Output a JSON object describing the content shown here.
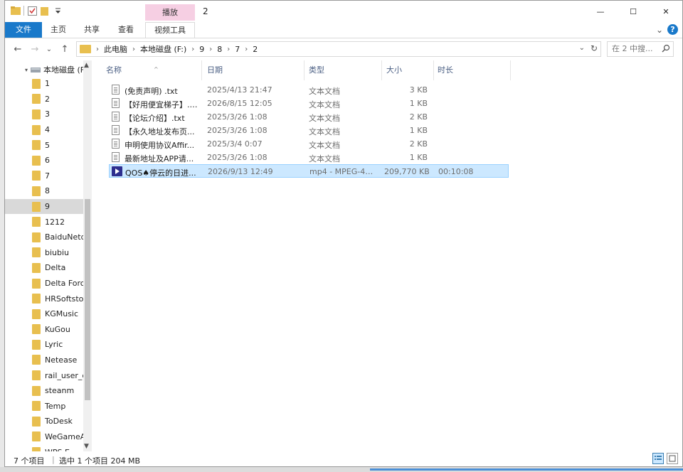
{
  "window": {
    "title": "2",
    "context_tab_group": "播放",
    "controls": {
      "minimize": "—",
      "maximize": "☐",
      "close": "✕"
    }
  },
  "ribbon": {
    "tabs": [
      {
        "label": "文件",
        "active": true
      },
      {
        "label": "主页"
      },
      {
        "label": "共享"
      },
      {
        "label": "查看"
      },
      {
        "label": "视频工具"
      }
    ],
    "collapse_glyph": "⌄",
    "help_glyph": "?"
  },
  "address": {
    "breadcrumbs": [
      "此电脑",
      "本地磁盘 (F:)",
      "9",
      "8",
      "7",
      "2"
    ],
    "search_placeholder": "在 2 中搜...",
    "back_glyph": "←",
    "forward_glyph": "→",
    "up_glyph": "↑",
    "recent_glyph": "⌄",
    "dropdown_glyph": "⌄",
    "refresh_glyph": "↻"
  },
  "nav_pane": {
    "root": "本地磁盘 (F:)",
    "expand_glyph": "▾",
    "items": [
      {
        "label": "1"
      },
      {
        "label": "2"
      },
      {
        "label": "3"
      },
      {
        "label": "4"
      },
      {
        "label": "5"
      },
      {
        "label": "6"
      },
      {
        "label": "7"
      },
      {
        "label": "8"
      },
      {
        "label": "9",
        "selected": true
      },
      {
        "label": "1212"
      },
      {
        "label": "BaiduNetd"
      },
      {
        "label": "biubiu"
      },
      {
        "label": "Delta"
      },
      {
        "label": "Delta Forc"
      },
      {
        "label": "HRSoftsto"
      },
      {
        "label": "KGMusic"
      },
      {
        "label": "KuGou"
      },
      {
        "label": "Lyric"
      },
      {
        "label": "Netease"
      },
      {
        "label": "rail_user_c"
      },
      {
        "label": "steanm"
      },
      {
        "label": "Temp"
      },
      {
        "label": "ToDesk"
      },
      {
        "label": "WeGameA"
      },
      {
        "label": "WPS E..."
      }
    ],
    "scroll_up_glyph": "▲",
    "scroll_down_glyph": "▼"
  },
  "columns": {
    "name": "名称",
    "date": "日期",
    "type": "类型",
    "size": "大小",
    "duration": "时长",
    "sort_glyph": "^"
  },
  "files": [
    {
      "name": "(免责声明) .txt",
      "date": "2025/4/13 21:47",
      "type": "文本文档",
      "size": "3 KB",
      "duration": "",
      "kind": "txt"
    },
    {
      "name": "【好用便宜梯子】.txt",
      "date": "2026/8/15 12:05",
      "type": "文本文档",
      "size": "1 KB",
      "duration": "",
      "kind": "txt"
    },
    {
      "name": "【论坛介绍】.txt",
      "date": "2025/3/26 1:08",
      "type": "文本文档",
      "size": "2 KB",
      "duration": "",
      "kind": "txt"
    },
    {
      "name": "【永久地址发布页...",
      "date": "2025/3/26 1:08",
      "type": "文本文档",
      "size": "1 KB",
      "duration": "",
      "kind": "txt"
    },
    {
      "name": "申明使用协议Affir...",
      "date": "2025/3/4 0:07",
      "type": "文本文档",
      "size": "2 KB",
      "duration": "",
      "kind": "txt"
    },
    {
      "name": "最新地址及APP请...",
      "date": "2025/3/26 1:08",
      "type": "文本文档",
      "size": "1 KB",
      "duration": "",
      "kind": "txt"
    },
    {
      "name": "QOS♠停云的日进...",
      "date": "2026/9/13 12:49",
      "type": "mp4 - MPEG-4 ...",
      "size": "209,770 KB",
      "duration": "00:10:08",
      "kind": "video",
      "selected": true
    }
  ],
  "status": {
    "count": "7 个项目",
    "selection": "选中 1 个项目  204 MB"
  }
}
